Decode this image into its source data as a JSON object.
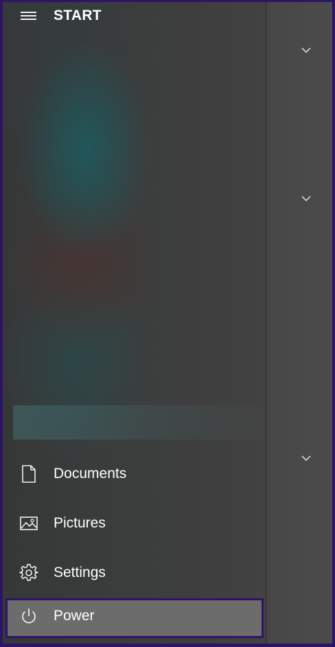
{
  "start_menu": {
    "title": "START",
    "hamburger_icon": "hamburger-menu-icon",
    "tile_groups_collapsed": 3
  },
  "nav": {
    "items": [
      {
        "label": "Documents",
        "icon": "document-icon"
      },
      {
        "label": "Pictures",
        "icon": "picture-icon"
      },
      {
        "label": "Settings",
        "icon": "gear-icon"
      },
      {
        "label": "Power",
        "icon": "power-icon",
        "highlighted": true
      }
    ]
  },
  "colors": {
    "frame_border": "#2d1466",
    "power_highlight": "#6c6c6c",
    "text": "#ffffff"
  }
}
